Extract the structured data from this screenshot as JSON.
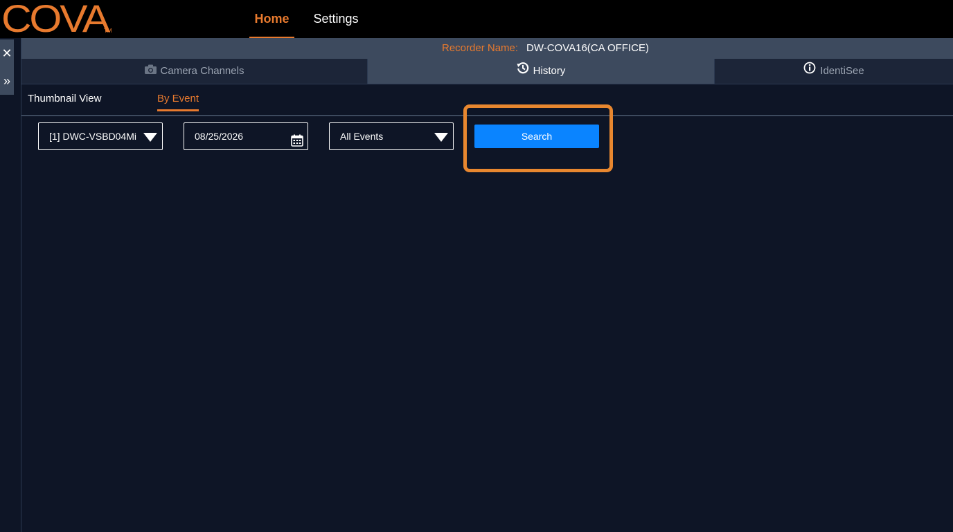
{
  "header": {
    "logo": "COVA",
    "logo_tm": "TM",
    "nav": [
      {
        "label": "Home",
        "active": true
      },
      {
        "label": "Settings",
        "active": false
      }
    ]
  },
  "left_rail": {
    "close_icon": "close-icon",
    "expand_icon": "double-chevron-right-icon"
  },
  "recorder": {
    "label": "Recorder Name:",
    "value": "DW-COVA16(CA OFFICE)"
  },
  "tabs": [
    {
      "label": "Camera Channels",
      "icon": "camera-icon",
      "active": false
    },
    {
      "label": "History",
      "icon": "history-icon",
      "active": true
    },
    {
      "label": "IdentiSee",
      "icon": "info-icon",
      "active": false
    }
  ],
  "subtabs": [
    {
      "label": "Thumbnail View",
      "active": false
    },
    {
      "label": "By Event",
      "active": true
    }
  ],
  "filters": {
    "camera": "[1] DWC-VSBD04Mi",
    "date": "08/25/2026",
    "event_type": "All Events",
    "search_label": "Search"
  },
  "colors": {
    "accent": "#e87a2e",
    "background": "#0e1526",
    "panel": "#3d4a5e",
    "search_button": "#0a84ff",
    "highlight": "#e8872f"
  }
}
